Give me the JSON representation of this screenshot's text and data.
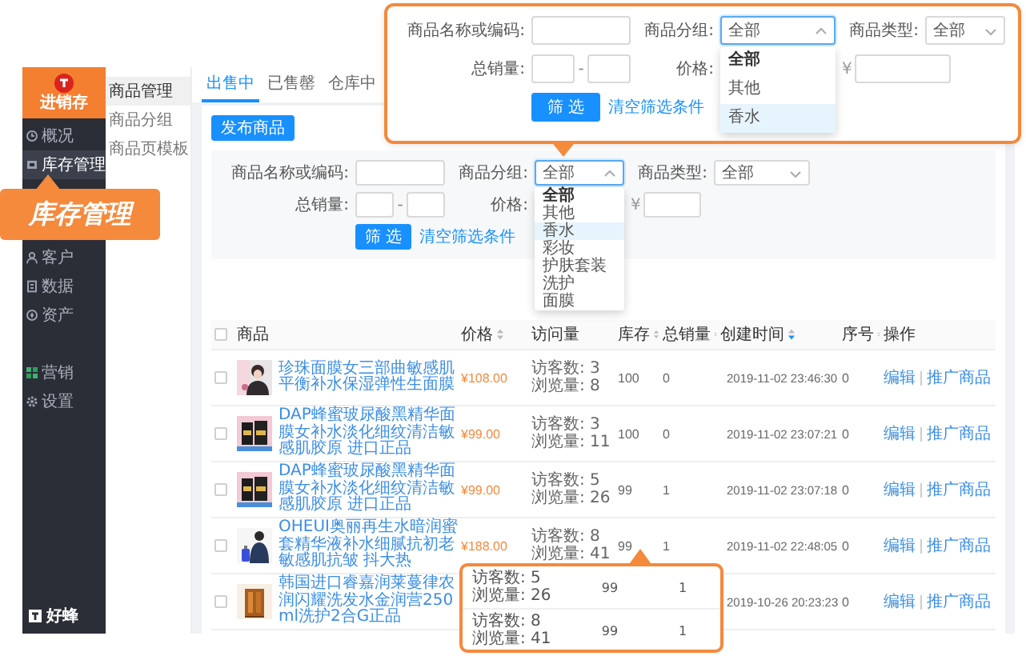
{
  "filter_callout": {
    "name_label": "商品名称或编码:",
    "group_label": "商品分组:",
    "group_select": {
      "value": "全部",
      "open": true
    },
    "type_label": "商品类型:",
    "type_select": {
      "value": "全部",
      "open": false
    },
    "sales_label": "总销量:",
    "sales_separator": "-",
    "price_label": "价格:",
    "currency": "¥",
    "submit": "筛 选",
    "clear": "清空筛选条件",
    "group_options": [
      {
        "label": "全部",
        "selected": true,
        "hovered": false
      },
      {
        "label": "其他",
        "selected": false,
        "hovered": false
      },
      {
        "label": "香水",
        "selected": false,
        "hovered": true
      }
    ]
  },
  "sidebar": {
    "logo": "进销存",
    "items": [
      {
        "label": "概况",
        "selected": false
      },
      {
        "label": "库存管理",
        "selected": true
      },
      {
        "label": "客户",
        "selected": false
      },
      {
        "label": "数据",
        "selected": false
      },
      {
        "label": "资产",
        "selected": false
      },
      {
        "label": "营销",
        "selected": false
      },
      {
        "label": "设置",
        "selected": false
      }
    ],
    "brand": "好蜂"
  },
  "submenu": {
    "items": [
      {
        "label": "商品管理",
        "selected": true
      },
      {
        "label": "商品分组",
        "selected": false
      },
      {
        "label": "商品页模板",
        "selected": false
      }
    ]
  },
  "menu_callout": {
    "label": "库存管理"
  },
  "tabs": [
    {
      "label": "出售中",
      "selected": true
    },
    {
      "label": "已售罄",
      "selected": false
    },
    {
      "label": "仓库中",
      "selected": false
    }
  ],
  "publish_button": "发布商品",
  "filter": {
    "name_label": "商品名称或编码:",
    "group_label": "商品分组:",
    "group_select": {
      "value": "全部",
      "open": true
    },
    "type_label": "商品类型:",
    "type_select": {
      "value": "全部",
      "open": false
    },
    "sales_label": "总销量:",
    "sales_separator": "-",
    "price_label": "价格:",
    "currency": "¥",
    "submit": "筛 选",
    "clear": "清空筛选条件",
    "group_options": [
      {
        "label": "全部",
        "selected": true,
        "hovered": false
      },
      {
        "label": "其他",
        "selected": false,
        "hovered": false
      },
      {
        "label": "香水",
        "selected": false,
        "hovered": true
      },
      {
        "label": "彩妆",
        "selected": false,
        "hovered": false
      },
      {
        "label": "护肤套装",
        "selected": false,
        "hovered": false
      },
      {
        "label": "洗护",
        "selected": false,
        "hovered": false
      },
      {
        "label": "面膜",
        "selected": false,
        "hovered": false
      }
    ]
  },
  "table": {
    "header_checked": false,
    "columns": [
      {
        "label": "商品",
        "sortable": false
      },
      {
        "label": "价格",
        "sortable": true,
        "sorted": false
      },
      {
        "label": "访问量",
        "sortable": false
      },
      {
        "label": "库存",
        "sortable": true,
        "sorted": false
      },
      {
        "label": "总销量",
        "sortable": true,
        "sorted": false
      },
      {
        "label": "创建时间",
        "sortable": true,
        "sorted": true
      },
      {
        "label": "序号",
        "sortable": true,
        "sorted": false
      },
      {
        "label": "操作",
        "sortable": false
      }
    ],
    "rows": [
      {
        "checked": false,
        "title": "珍珠面膜女三部曲敏感肌平衡补水保湿弹性生面膜",
        "price": "¥108.00",
        "visitors": "访客数: 3",
        "views": "浏览量: 8",
        "stock": "100",
        "sales": "0",
        "created": "2019-11-02 23:46:30",
        "seq": "0",
        "actions": [
          "编辑",
          "推广商品"
        ]
      },
      {
        "checked": false,
        "title": "DAP蜂蜜玻尿酸黑精华面膜女补水淡化细纹清洁敏感肌胶原 进口正品",
        "price": "¥99.00",
        "visitors": "访客数: 3",
        "views": "浏览量: 11",
        "stock": "100",
        "sales": "0",
        "created": "2019-11-02 23:07:21",
        "seq": "0",
        "actions": [
          "编辑",
          "推广商品"
        ]
      },
      {
        "checked": false,
        "title": "DAP蜂蜜玻尿酸黑精华面膜女补水淡化细纹清洁敏感肌胶原 进口正品",
        "price": "¥99.00",
        "visitors": "访客数: 5",
        "views": "浏览量: 26",
        "stock": "99",
        "sales": "1",
        "created": "2019-11-02 23:07:18",
        "seq": "0",
        "actions": [
          "编辑",
          "推广商品"
        ]
      },
      {
        "checked": false,
        "title": "OHEUI奥丽再生水暗润蜜套精华液补水细腻抗初老敏感肌抗皱 抖大热",
        "price": "¥188.00",
        "visitors": "访客数: 8",
        "views": "浏览量: 41",
        "stock": "99",
        "sales": "1",
        "created": "2019-11-02 22:48:05",
        "seq": "0",
        "actions": [
          "编辑",
          "推广商品"
        ]
      },
      {
        "checked": false,
        "title": "韩国进口睿嘉润莱蔓律农润闪耀洗发水金润营250ml洗护2合G正品",
        "created": "2019-10-26 20:23:23",
        "seq": "0",
        "actions": [
          "编辑",
          "推广商品"
        ]
      }
    ]
  },
  "table_callout": {
    "rows": [
      {
        "visitors": "访客数: 5",
        "views": "浏览量: 26",
        "stock": "99",
        "sales": "1"
      },
      {
        "visitors": "访客数: 8",
        "views": "浏览量: 41",
        "stock": "99",
        "sales": "1"
      }
    ]
  }
}
